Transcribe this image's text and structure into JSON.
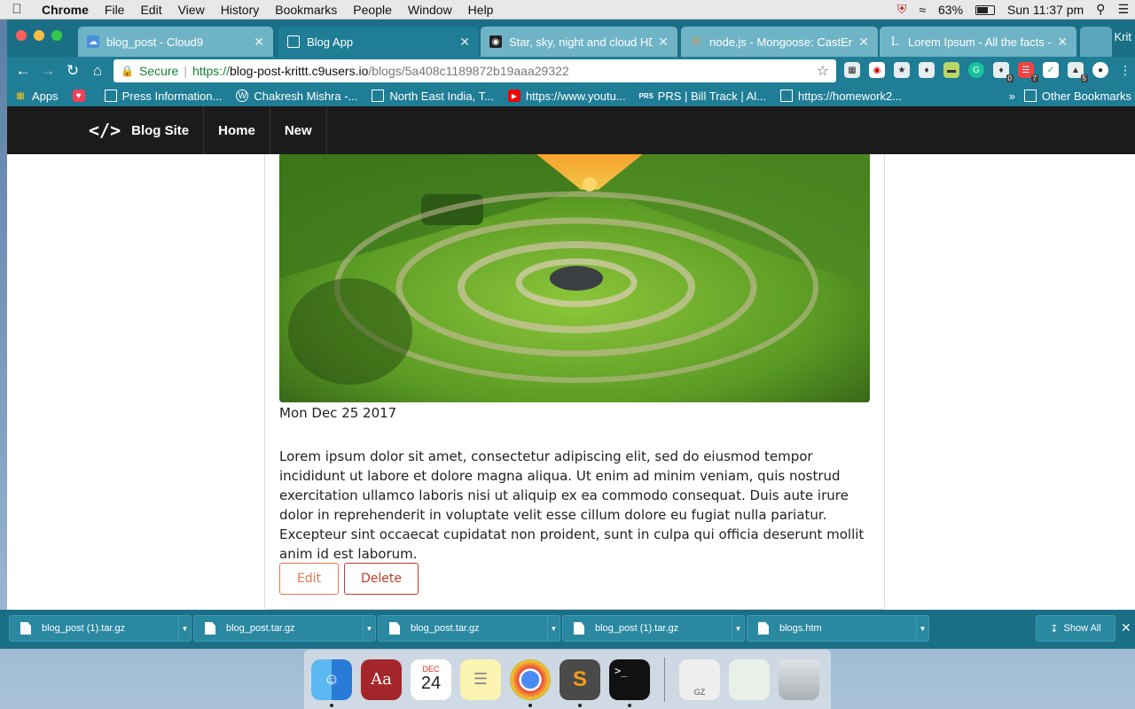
{
  "menubar": {
    "app_name": "Chrome",
    "menus": [
      "File",
      "Edit",
      "View",
      "History",
      "Bookmarks",
      "People",
      "Window",
      "Help"
    ],
    "battery": "63%",
    "clock": "Sun 11:37 pm"
  },
  "tabs": [
    {
      "title": "blog_post - Cloud9",
      "icon": "cloud9-icon",
      "active": false
    },
    {
      "title": "Blog App",
      "icon": "page-icon",
      "active": true
    },
    {
      "title": "Star, sky, night and cloud HD",
      "icon": "camera-icon",
      "active": false
    },
    {
      "title": "node.js - Mongoose: CastErro",
      "icon": "stackoverflow-icon",
      "active": false
    },
    {
      "title": "Lorem Ipsum - All the facts - ",
      "icon": "lipsum-icon",
      "active": false
    }
  ],
  "profile_name": "Krit",
  "omnibox": {
    "secure_label": "Secure",
    "scheme": "https://",
    "host": "blog-post-krittt.c9users.io",
    "path": "/blogs/5a408c1189872b19aaa29322"
  },
  "extension_badges": {
    "ext_badge_1": "0",
    "ext_badge_2": "7",
    "ext_badge_3": "5"
  },
  "bookmarks": [
    {
      "label": "Apps",
      "icon": "apps-grid-icon"
    },
    {
      "label": "",
      "icon": "pocket-icon"
    },
    {
      "label": "Press Information...",
      "icon": "page-icon"
    },
    {
      "label": "Chakresh Mishra -...",
      "icon": "wordpress-icon"
    },
    {
      "label": "North East India, T...",
      "icon": "page-icon"
    },
    {
      "label": "https://www.youtu...",
      "icon": "youtube-icon"
    },
    {
      "label": "PRS | Bill Track | Al...",
      "icon": "prs-icon"
    },
    {
      "label": "https://homework2...",
      "icon": "page-icon"
    }
  ],
  "other_bookmarks": "Other Bookmarks",
  "site": {
    "brand": "Blog Site",
    "nav": [
      "Home",
      "New"
    ]
  },
  "post": {
    "date": "Mon Dec 25 2017",
    "body": "Lorem ipsum dolor sit amet, consectetur adipiscing elit, sed do eiusmod tempor incididunt ut labore et dolore magna aliqua. Ut enim ad minim veniam, quis nostrud exercitation ullamco laboris nisi ut aliquip ex ea commodo consequat. Duis aute irure dolor in reprehenderit in voluptate velit esse cillum dolore eu fugiat nulla pariatur. Excepteur sint occaecat cupidatat non proident, sunt in culpa qui officia deserunt mollit anim id est laborum.",
    "edit_label": "Edit",
    "delete_label": "Delete"
  },
  "downloads": [
    {
      "name": "blog_post (1).tar.gz"
    },
    {
      "name": "blog_post.tar.gz"
    },
    {
      "name": "blog_post.tar.gz"
    },
    {
      "name": "blog_post (1).tar.gz"
    },
    {
      "name": "blogs.htm"
    }
  ],
  "show_all_label": "Show All",
  "dock": {
    "calendar_month": "DEC",
    "calendar_day": "24",
    "dictionary_label": "Aa",
    "archive_label": "GZ"
  },
  "colors": {
    "chrome_frame": "#1a6f86",
    "site_nav": "#1b1b1b",
    "edit_button": "#e8734f",
    "delete_button": "#c0392b"
  }
}
